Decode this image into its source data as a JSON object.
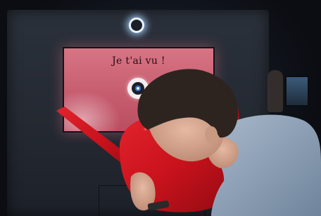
{
  "display": {
    "message": "Je t'ai vu !"
  },
  "icons": {
    "eye": "eye-icon",
    "ring_light": "ring-light-icon"
  },
  "colors": {
    "screen_pink": "#c9606f",
    "watering_can_red": "#c8121c",
    "cabinet_dark": "#262b34",
    "sweater_blue": "#8fa2b8"
  }
}
